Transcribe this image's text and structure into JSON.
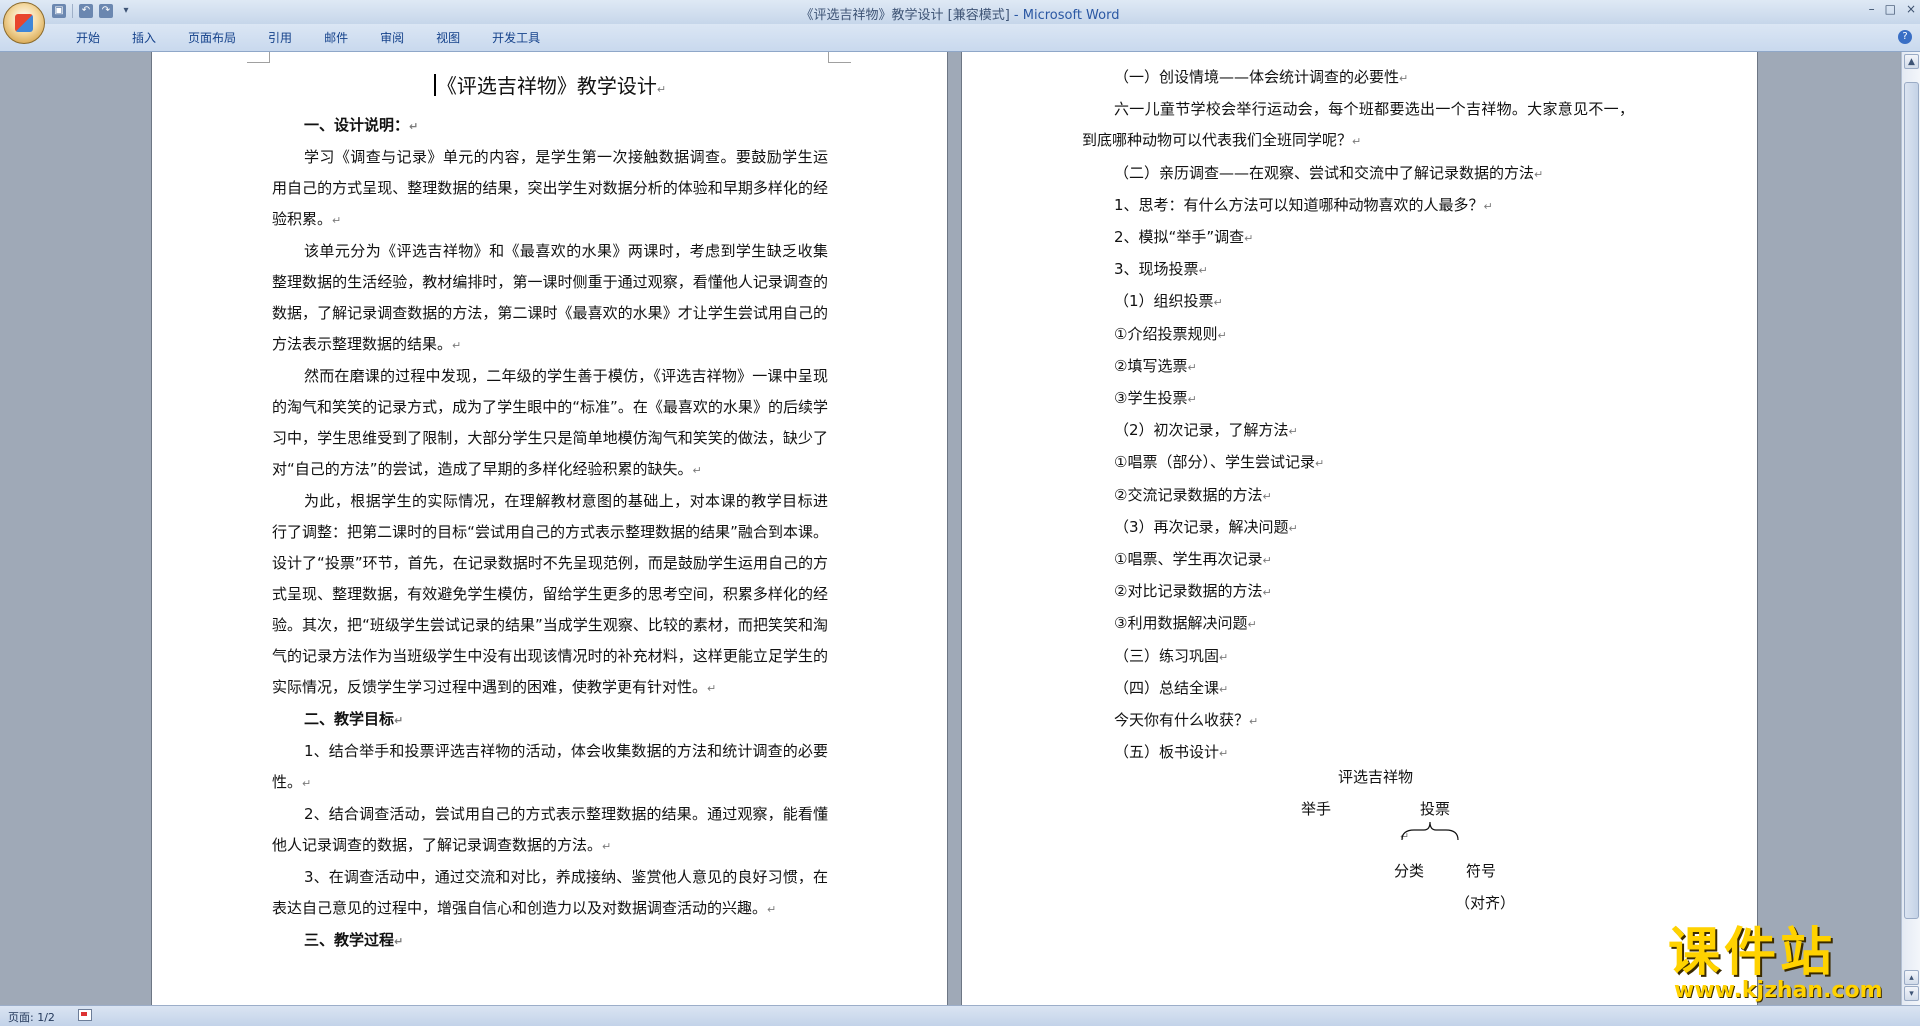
{
  "window": {
    "title": "《评选吉祥物》教学设计 [兼容模式]",
    "app_name": "Microsoft Word",
    "title_separator": " - ",
    "controls": [
      "–",
      "□",
      "×"
    ]
  },
  "quick_access": {
    "icons": [
      "save-icon",
      "undo-icon",
      "redo-icon",
      "customize-icon"
    ]
  },
  "ribbon": {
    "tabs": [
      "开始",
      "插入",
      "页面布局",
      "引用",
      "邮件",
      "审阅",
      "视图",
      "开发工具"
    ],
    "help_label": "?"
  },
  "doc_left": {
    "title": "《评选吉祥物》教学设计",
    "paragraphs": [
      {
        "text": "一、设计说明：",
        "heading": true
      },
      {
        "text": "学习《调查与记录》单元的内容，是学生第一次接触数据调查。要鼓励学生运用自己的方式呈现、整理数据的结果，突出学生对数据分析的体验和早期多样化的经验积累。"
      },
      {
        "text": "该单元分为《评选吉祥物》和《最喜欢的水果》两课时，考虑到学生缺乏收集整理数据的生活经验，教材编排时，第一课时侧重于通过观察，看懂他人记录调查的数据，了解记录调查数据的方法，第二课时《最喜欢的水果》才让学生尝试用自己的方法表示整理数据的结果。"
      },
      {
        "text": "然而在磨课的过程中发现，二年级的学生善于模仿，《评选吉祥物》一课中呈现的淘气和笑笑的记录方式，成为了学生眼中的“标准”。在《最喜欢的水果》的后续学习中，学生思维受到了限制，大部分学生只是简单地模仿淘气和笑笑的做法，缺少了对“自己的方法”的尝试，造成了早期的多样化经验积累的缺失。"
      },
      {
        "text": "为此，根据学生的实际情况，在理解教材意图的基础上，对本课的教学目标进行了调整：把第二课时的目标“尝试用自己的方式表示整理数据的结果”融合到本课。设计了“投票”环节，首先，在记录数据时不先呈现范例，而是鼓励学生运用自己的方式呈现、整理数据，有效避免学生模仿，留给学生更多的思考空间，积累多样化的经验。其次，把“班级学生尝试记录的结果”当成学生观察、比较的素材，而把笑笑和淘气的记录方法作为当班级学生中没有出现该情况时的补充材料，这样更能立足学生的实际情况，反馈学生学习过程中遇到的困难，使教学更有针对性。"
      },
      {
        "text": "二、教学目标",
        "heading": true
      },
      {
        "text": "1、结合举手和投票评选吉祥物的活动，体会收集数据的方法和统计调查的必要性。"
      },
      {
        "text": "2、结合调查活动，尝试用自己的方式表示整理数据的结果。通过观察，能看懂他人记录调查的数据，了解记录调查数据的方法。"
      },
      {
        "text": "3、在调查活动中，通过交流和对比，养成接纳、鉴赏他人意见的良好习惯，在表达自己意见的过程中，增强自信心和创造力以及对数据调查活动的兴趣。"
      },
      {
        "text": "三、教学过程",
        "heading": true
      }
    ]
  },
  "doc_right": {
    "paragraphs": [
      {
        "text": "（一）创设情境——体会统计调查的必要性"
      },
      {
        "text": "六一儿童节学校会举行运动会，每个班都要选出一个吉祥物。大家意见不一，到底哪种动物可以代表我们全班同学呢？",
        "wrap": true
      },
      {
        "text": "（二）亲历调查——在观察、尝试和交流中了解记录数据的方法"
      },
      {
        "text": "1、思考：有什么方法可以知道哪种动物喜欢的人最多？"
      },
      {
        "text": "2、模拟“举手”调查"
      },
      {
        "text": "3、现场投票"
      },
      {
        "text": "（1）组织投票"
      },
      {
        "text": "①介绍投票规则"
      },
      {
        "text": "②填写选票"
      },
      {
        "text": "③学生投票"
      },
      {
        "text": "（2）初次记录，了解方法"
      },
      {
        "text": "①唱票（部分）、学生尝试记录"
      },
      {
        "text": "②交流记录数据的方法"
      },
      {
        "text": "（3）再次记录，解决问题"
      },
      {
        "text": "①唱票、学生再次记录"
      },
      {
        "text": "②对比记录数据的方法"
      },
      {
        "text": "③利用数据解决问题"
      },
      {
        "text": "（三）练习巩固"
      },
      {
        "text": "（四）总结全课"
      },
      {
        "text": "今天你有什么收获？"
      },
      {
        "text": "（五）板书设计"
      }
    ],
    "board": {
      "title": "评选吉祥物",
      "left": "举手",
      "right": "投票",
      "branch_left": "分类",
      "branch_right": "符号",
      "note": "（对齐）"
    }
  },
  "status": {
    "page": "页面: 1/2"
  },
  "watermark": {
    "brand": "课件站",
    "url": "www.kjzhan.com"
  }
}
